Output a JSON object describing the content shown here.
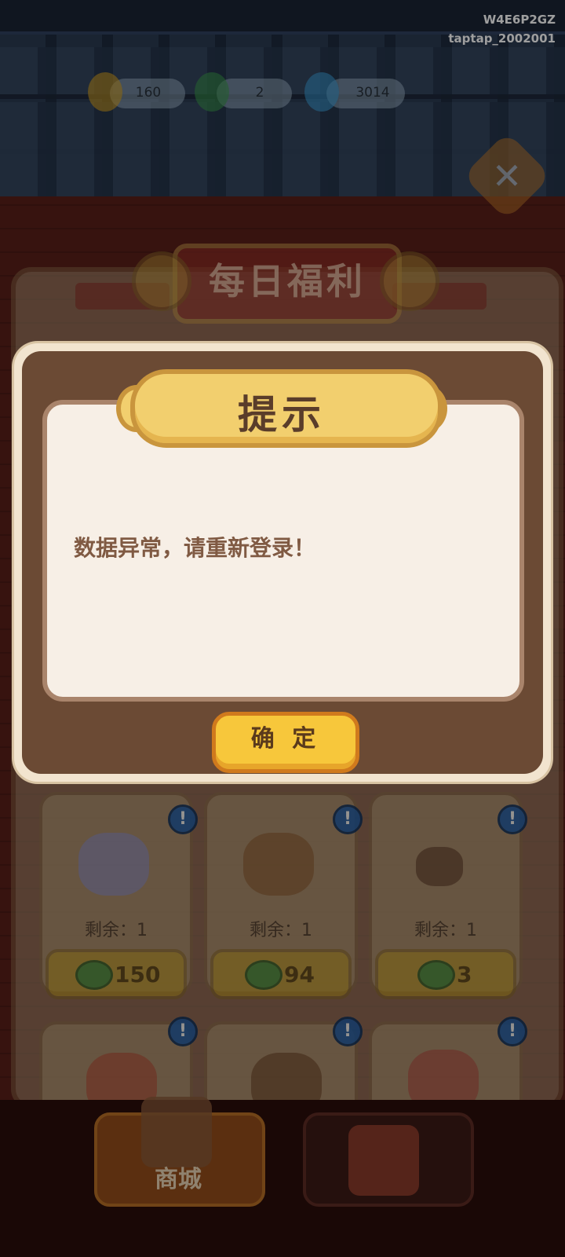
{
  "watermark": {
    "line1": "W4E6P2GZ",
    "line2": "taptap_2002001"
  },
  "currency": [
    {
      "icon": "gold-ingot-icon",
      "value": "160"
    },
    {
      "icon": "jade-coin-icon",
      "value": "2"
    },
    {
      "icon": "blue-flame-icon",
      "value": "3014"
    }
  ],
  "panel": {
    "title": "每日福利"
  },
  "items": [
    {
      "icon": "magic-mirror-icon",
      "remain": "剩余：1",
      "price": "150"
    },
    {
      "icon": "dim-sum-basket-icon",
      "remain": "剩余：1",
      "price": "94"
    },
    {
      "icon": "spoon-icon",
      "remain": "剩余：1",
      "price": "3"
    },
    {
      "icon": "ham-icon"
    },
    {
      "icon": "jar-icon"
    },
    {
      "icon": "lantern-icon"
    }
  ],
  "nav": {
    "shop_label": "商城"
  },
  "dialog": {
    "title": "提示",
    "message": "数据异常，请重新登录！",
    "confirm_label": "确 定"
  },
  "colors": {
    "dialog_frame": "#6b4a34",
    "dialog_body": "#f7efe6",
    "confirm_button": "#f7c73b",
    "message_text": "#805a43"
  }
}
